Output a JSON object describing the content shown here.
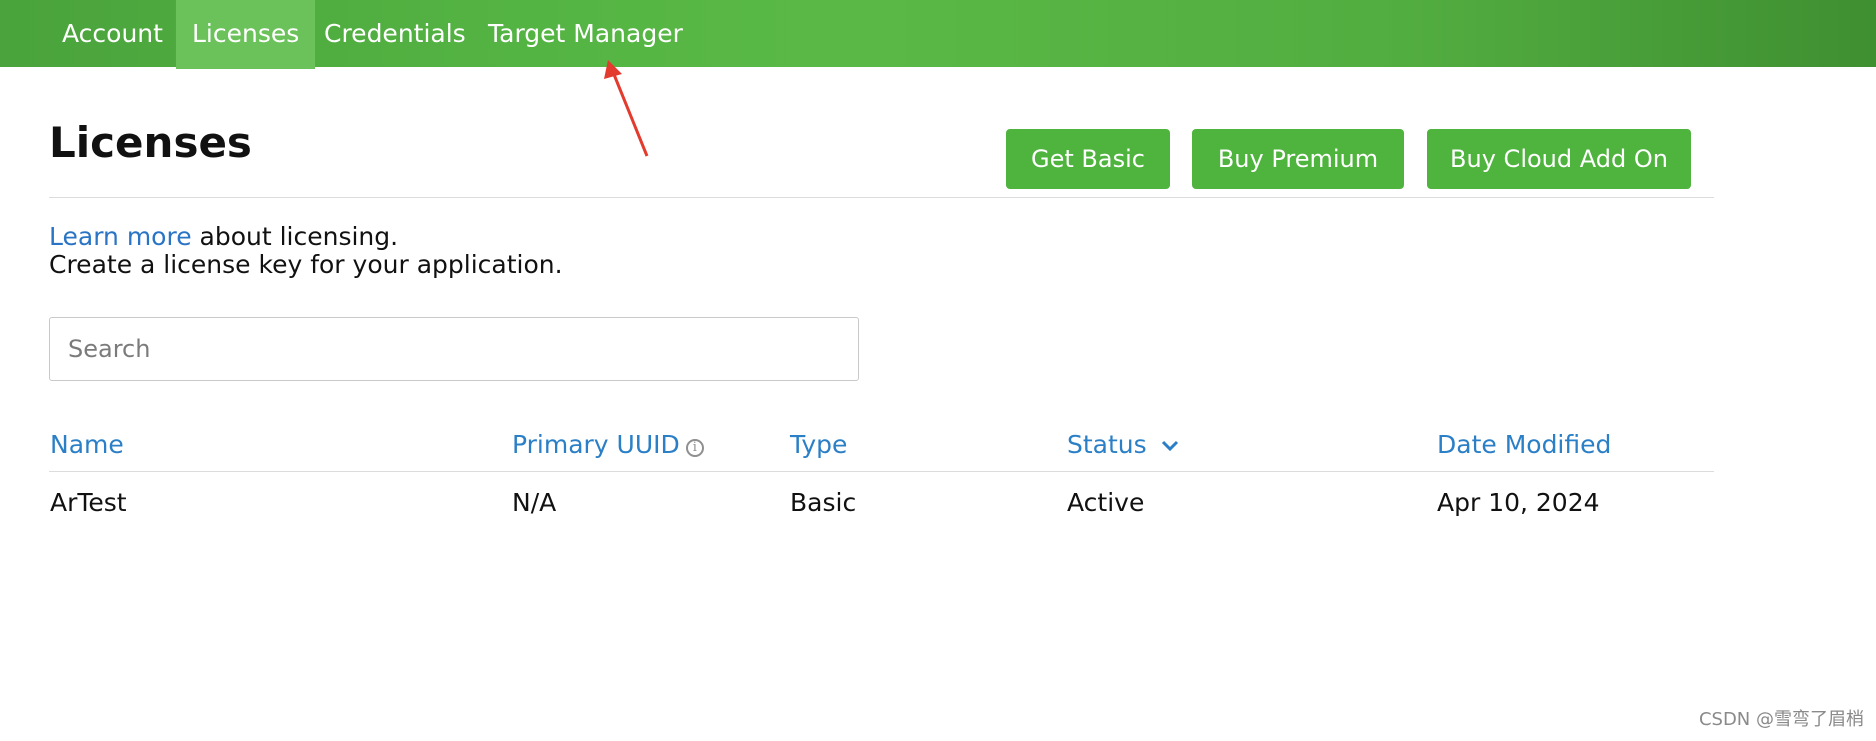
{
  "nav": {
    "items": [
      {
        "label": "Account"
      },
      {
        "label": "Licenses",
        "active": true
      },
      {
        "label": "Credentials"
      },
      {
        "label": "Target Manager"
      }
    ]
  },
  "header": {
    "title": "Licenses",
    "buttons": {
      "get_basic": "Get Basic",
      "buy_premium": "Buy Premium",
      "buy_cloud": "Buy Cloud Add On"
    }
  },
  "intro": {
    "link_text": "Learn more",
    "line1_rest": " about licensing.",
    "line2": "Create a license key for your application."
  },
  "search": {
    "placeholder": "Search"
  },
  "table": {
    "columns": {
      "name": "Name",
      "primary_uuid": "Primary UUID",
      "type": "Type",
      "status": "Status",
      "date_modified": "Date Modified"
    },
    "rows": [
      {
        "name": "ArTest",
        "primary_uuid": "N/A",
        "type": "Basic",
        "status": "Active",
        "date_modified": "Apr 10, 2024"
      }
    ]
  },
  "icons": {
    "info": "info-icon",
    "status_sort": "chevron-down-icon"
  },
  "colors": {
    "nav_green": "#54b443",
    "button_green": "#4fb43e",
    "link_blue": "#2a74c5",
    "annotation_red": "#e33b2e"
  },
  "watermark": "CSDN @雪弯了眉梢"
}
